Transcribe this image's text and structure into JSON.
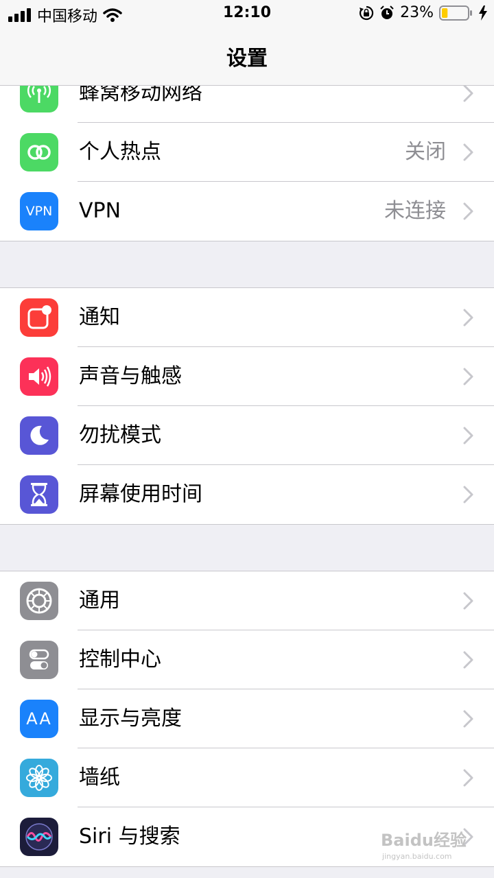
{
  "status_bar": {
    "carrier": "中国移动",
    "time": "12:10",
    "battery": "23%",
    "battery_level": 0.23
  },
  "nav": {
    "title": "设置"
  },
  "groups": [
    [
      {
        "label": "蜂窝移动网络",
        "value": "",
        "icon": "antenna-icon",
        "color": "#4cd964"
      },
      {
        "label": "个人热点",
        "value": "关闭",
        "icon": "hotspot-icon",
        "color": "#4cd964"
      },
      {
        "label": "VPN",
        "value": "未连接",
        "icon": "vpn-icon",
        "icon_text": "VPN",
        "color": "#1a82fb"
      }
    ],
    [
      {
        "label": "通知",
        "value": "",
        "icon": "notifications-icon",
        "color": "#fc3d39"
      },
      {
        "label": "声音与触感",
        "value": "",
        "icon": "speaker-icon",
        "color": "#fc3158"
      },
      {
        "label": "勿扰模式",
        "value": "",
        "icon": "moon-icon",
        "color": "#5856d6"
      },
      {
        "label": "屏幕使用时间",
        "value": "",
        "icon": "hourglass-icon",
        "color": "#5856d6"
      }
    ],
    [
      {
        "label": "通用",
        "value": "",
        "icon": "gear-icon",
        "color": "#8e8e93"
      },
      {
        "label": "控制中心",
        "value": "",
        "icon": "toggles-icon",
        "color": "#8e8e93"
      },
      {
        "label": "显示与亮度",
        "value": "",
        "icon": "display-icon",
        "icon_text": "AA",
        "color": "#1a82fb"
      },
      {
        "label": "墙纸",
        "value": "",
        "icon": "flower-icon",
        "color": "#35aadc"
      },
      {
        "label": "Siri 与搜索",
        "value": "",
        "icon": "siri-icon",
        "color": "#1c1c3a"
      }
    ]
  ],
  "watermark": {
    "brand": "Baidu经验",
    "url": "jingyan.baidu.com"
  }
}
